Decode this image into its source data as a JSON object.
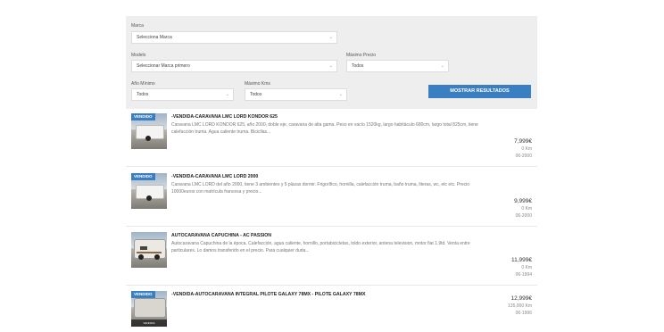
{
  "filters": {
    "marca": {
      "label": "Marca",
      "value": "Selecciona Marca"
    },
    "modelo": {
      "label": "Modelo",
      "value": "Seleccionar Marca primero"
    },
    "maximo_precio": {
      "label": "Máximo Precio",
      "value": "Todos"
    },
    "ano_minimo": {
      "label": "Año Mínimo",
      "value": "Todos"
    },
    "maximo_kms": {
      "label": "Máximo Kms",
      "value": "Todos"
    },
    "submit_label": "MOSTRAR RESULTADOS"
  },
  "listings": [
    {
      "badge": "VENDIDO",
      "title": "-VENDIDA-CARAVANA LMC LORD KONDOR 625",
      "description": "Caravana LMC LORD KONDOR 625, año 2000, doble eje, caravana de alta gama. Peso en vacío 1520kg, largo habitáculo 680cm, largo total 825cm, tiene calefacción truma. Agua caliente truma. Bicicllas...",
      "price": "7,999€",
      "km": "0 Km",
      "date": "06-2000"
    },
    {
      "badge": "VENDIDO",
      "title": "-VENDIDA-CARAVANA LMC LORD 2000",
      "description": "Caravana LMC LORD del año 2000, tiene 3 ambientes y 5 plazas dormir. Frigorífico, hornilla, calefacción truma, baño truma, literas, wc, etc etc. Precio 10000euros con matrícula francesa y precio...",
      "price": "9,999€",
      "km": "0 Km",
      "date": "06-2000"
    },
    {
      "badge": "",
      "title": "AUTOCARAVANA CAPUCHINA - AC PASSION",
      "description": "Autocaravana Capuchina de la época. Calefacción, agua caliente, hornillo, portabicicletas, toldo exterior, antena television, motor fiat 1.9td. Venta entre particulares. Lo damos transferido en el precio. Para cualquier duda...",
      "price": "11,999€",
      "km": "0 Km",
      "date": "06-1994"
    },
    {
      "badge": "VENDIDO",
      "title": "-VENDIDA-AUTOCARAVANA INTEGRAL PILOTE GALAXY 78MX - PILOTE GALAXY 78MX",
      "description": "",
      "price": "12,999€",
      "km": "135,000 Km",
      "date": "06-1996",
      "thumb_footer": "VENDIDA"
    }
  ]
}
